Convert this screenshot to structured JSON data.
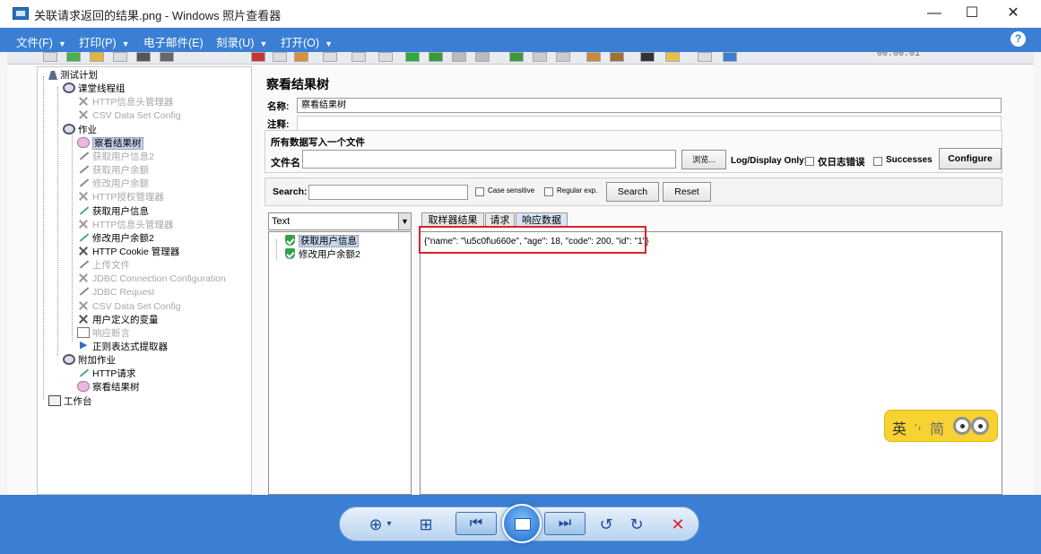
{
  "window": {
    "title": "关联请求返回的结果.png - Windows 照片查看器",
    "minimize": "—",
    "maximize": "☐",
    "close": "✕"
  },
  "menubar": {
    "items": [
      {
        "label": "文件(F)"
      },
      {
        "label": "打印(P)"
      },
      {
        "label": "电子邮件(E)"
      },
      {
        "label": "刻录(U)"
      },
      {
        "label": "打开(O)"
      }
    ],
    "help": "?"
  },
  "jmeter": {
    "toolbar_time": "00:00:01",
    "tree": [
      {
        "label": "测试计划",
        "icon": "flask-icon",
        "level": 0,
        "disabled": false,
        "selected": false
      },
      {
        "label": "课堂线程组",
        "icon": "gear-icon",
        "level": 1,
        "disabled": false,
        "selected": false
      },
      {
        "label": "HTTP信息头管理器",
        "icon": "cross-icon",
        "level": 2,
        "disabled": true,
        "selected": false
      },
      {
        "label": "CSV Data Set Config",
        "icon": "cross-icon",
        "level": 2,
        "disabled": true,
        "selected": false
      },
      {
        "label": "作业",
        "icon": "gear-icon",
        "level": 1,
        "disabled": false,
        "selected": false
      },
      {
        "label": "察看结果树",
        "icon": "view-icon",
        "level": 2,
        "disabled": false,
        "selected": true
      },
      {
        "label": "获取用户信息2",
        "icon": "wrench-icon",
        "level": 2,
        "disabled": true,
        "selected": false
      },
      {
        "label": "获取用户余额",
        "icon": "wrench-icon",
        "level": 2,
        "disabled": true,
        "selected": false
      },
      {
        "label": "修改用户余额",
        "icon": "wrench-icon",
        "level": 2,
        "disabled": true,
        "selected": false
      },
      {
        "label": "HTTP授权管理器",
        "icon": "cross-icon",
        "level": 2,
        "disabled": true,
        "selected": false
      },
      {
        "label": "获取用户信息",
        "icon": "wrench-icon",
        "level": 2,
        "disabled": false,
        "selected": false
      },
      {
        "label": "HTTP信息头管理器",
        "icon": "cross-icon",
        "level": 2,
        "disabled": true,
        "selected": false
      },
      {
        "label": "修改用户余额2",
        "icon": "wrench-icon",
        "level": 2,
        "disabled": false,
        "selected": false
      },
      {
        "label": "HTTP Cookie 管理器",
        "icon": "cross-icon",
        "level": 2,
        "disabled": false,
        "selected": false
      },
      {
        "label": "上传文件",
        "icon": "wrench-icon",
        "level": 2,
        "disabled": true,
        "selected": false
      },
      {
        "label": "JDBC Connection Configuration",
        "icon": "cross-icon",
        "level": 2,
        "disabled": true,
        "selected": false
      },
      {
        "label": "JDBC Request",
        "icon": "wrench-icon",
        "level": 2,
        "disabled": true,
        "selected": false
      },
      {
        "label": "CSV Data Set Config",
        "icon": "cross-icon",
        "level": 2,
        "disabled": true,
        "selected": false
      },
      {
        "label": "用户定义的变量",
        "icon": "cross-icon",
        "level": 2,
        "disabled": false,
        "selected": false
      },
      {
        "label": "响应断言",
        "icon": "page-icon",
        "level": 2,
        "disabled": true,
        "selected": false
      },
      {
        "label": "正则表达式提取器",
        "icon": "arrow-icon",
        "level": 2,
        "disabled": false,
        "selected": false
      },
      {
        "label": "附加作业",
        "icon": "gear-icon",
        "level": 1,
        "disabled": false,
        "selected": false
      },
      {
        "label": "HTTP请求",
        "icon": "wrench-icon",
        "level": 2,
        "disabled": false,
        "selected": false
      },
      {
        "label": "察看结果树",
        "icon": "view-icon",
        "level": 2,
        "disabled": false,
        "selected": false
      },
      {
        "label": "工作台",
        "icon": "bench-icon",
        "level": 0,
        "disabled": false,
        "selected": false
      }
    ],
    "panel": {
      "title": "察看结果树",
      "name_label": "名称:",
      "name_value": "察看结果树",
      "comment_label": "注释:",
      "comment_value": "",
      "file_group_title": "所有数据写入一个文件",
      "filename_label": "文件名",
      "filename_value": "",
      "browse": "浏览...",
      "log_display_only": "Log/Display Only:",
      "errors_only": "仅日志错误",
      "successes": "Successes",
      "configure": "Configure",
      "search_label": "Search:",
      "search_value": "",
      "case_sensitive": "Case sensitive",
      "regular_exp": "Regular exp.",
      "search_btn": "Search",
      "reset_btn": "Reset",
      "renderer": "Text",
      "samples": [
        {
          "label": "获取用户信息",
          "selected": true
        },
        {
          "label": "修改用户余额2",
          "selected": false
        }
      ],
      "tabs": [
        {
          "label": "取样器结果",
          "active": false
        },
        {
          "label": "请求",
          "active": false
        },
        {
          "label": "响应数据",
          "active": true
        }
      ],
      "response_text": "{\"name\": \"\\u5c0f\\u660e\", \"age\": 18, \"code\": 200, \"id\": \"1\"}"
    }
  },
  "ime": {
    "lang": "英",
    "separator": "·,",
    "mode": "简"
  },
  "viewer_controls": {
    "zoom": "⊕",
    "zoom_caret": "▾",
    "actual_size": "⊞",
    "previous": "⏮",
    "slideshow": "",
    "next": "⏭",
    "rotate_ccw": "↺",
    "rotate_cw": "↻",
    "delete": "✕"
  },
  "colors": {
    "accent": "#3a7fd3",
    "highlight": "#e0202a",
    "ime_bg": "#f6d233"
  }
}
